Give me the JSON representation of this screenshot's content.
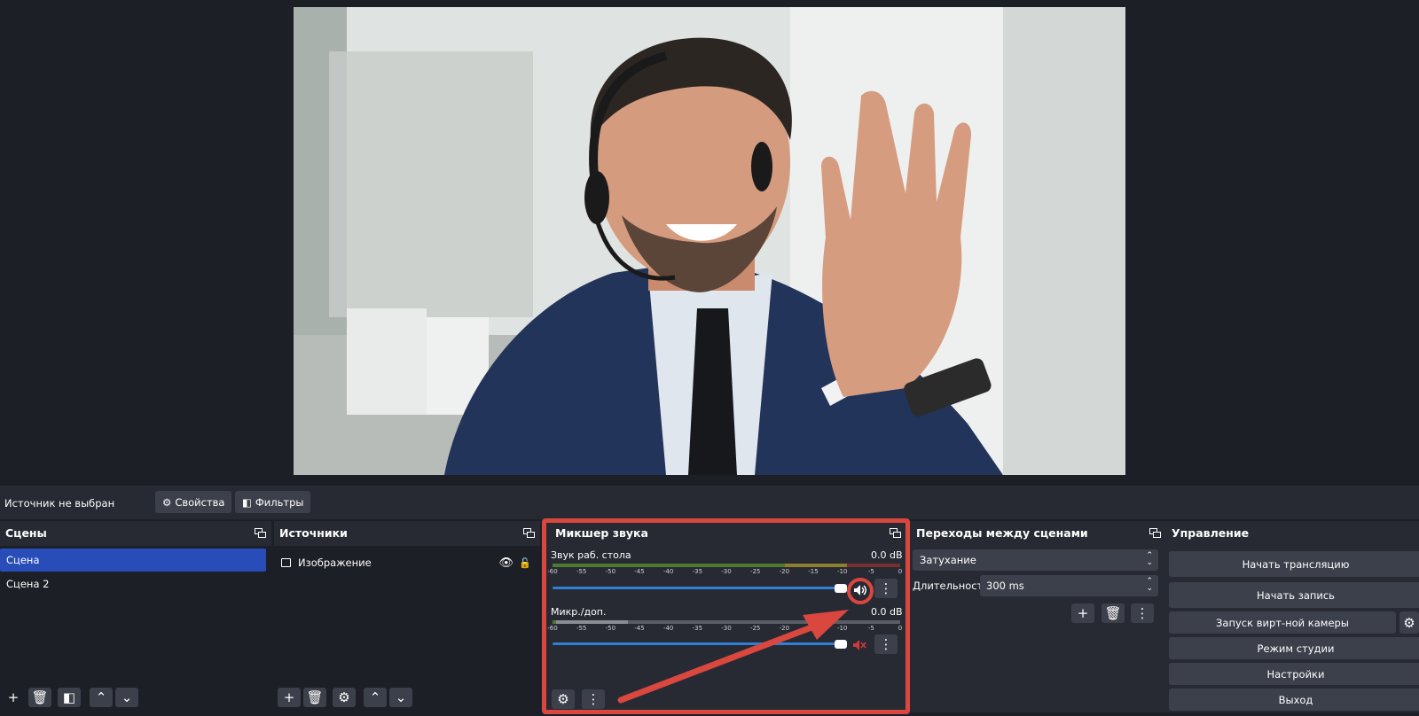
{
  "source_toolbar": {
    "no_source": "Источник не выбран",
    "properties": "Свойства",
    "filters": "Фильтры"
  },
  "scenes": {
    "title": "Сцены",
    "items": [
      "Сцена",
      "Сцена 2"
    ],
    "active_index": 0
  },
  "sources": {
    "title": "Источники",
    "items": [
      {
        "label": "Изображение",
        "icon": "image-icon",
        "visible": true,
        "locked": false
      }
    ]
  },
  "mixer": {
    "title": "Микшер звука",
    "tick_labels": [
      "-60",
      "-55",
      "-50",
      "-45",
      "-40",
      "-35",
      "-30",
      "-25",
      "-20",
      "-15",
      "-10",
      "-5",
      "0"
    ],
    "channels": [
      {
        "name": "Звук раб. стола",
        "db": "0.0 dB",
        "muted": false
      },
      {
        "name": "Микр./доп.",
        "db": "0.0 dB",
        "muted": true
      }
    ]
  },
  "transitions": {
    "title": "Переходы между сценами",
    "selected": "Затухание",
    "duration_label": "Длительность",
    "duration_value": "300 ms"
  },
  "controls": {
    "title": "Управление",
    "buttons": [
      "Начать трансляцию",
      "Начать запись",
      "Запуск вирт-ной камеры",
      "Режим студии",
      "Настройки",
      "Выход"
    ]
  },
  "colors": {
    "accent": "#284cb8",
    "annotation": "#d9473e",
    "fader": "#2f7fd6",
    "meter_green": "#4c7a2e",
    "meter_yellow": "#8d7f2c",
    "meter_red": "#7a2f2f"
  }
}
